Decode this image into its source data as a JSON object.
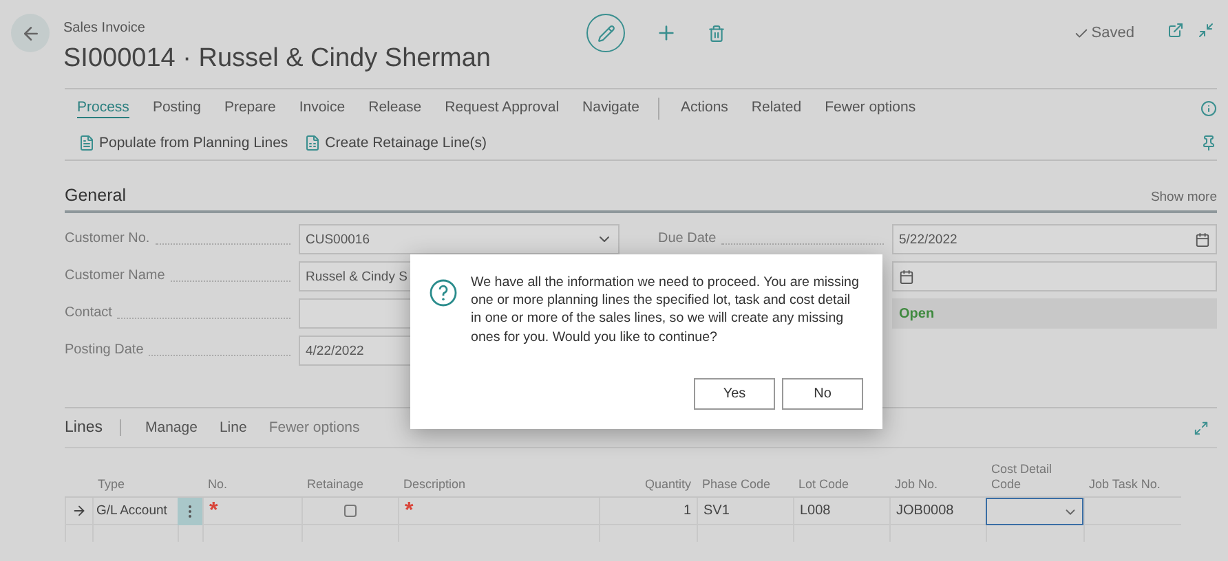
{
  "header": {
    "caption": "Sales Invoice",
    "title": "SI000014 · Russel & Cindy Sherman",
    "status": "Saved"
  },
  "action_tabs": [
    {
      "label": "Process",
      "selected": true
    },
    {
      "label": "Posting",
      "selected": false
    },
    {
      "label": "Prepare",
      "selected": false
    },
    {
      "label": "Invoice",
      "selected": false
    },
    {
      "label": "Release",
      "selected": false
    },
    {
      "label": "Request Approval",
      "selected": false
    },
    {
      "label": "Navigate",
      "selected": false
    },
    {
      "label": "Actions",
      "selected": false
    },
    {
      "label": "Related",
      "selected": false
    },
    {
      "label": "Fewer options",
      "selected": false
    }
  ],
  "actions": [
    "Populate from Planning Lines",
    "Create Retainage Line(s)"
  ],
  "general": {
    "title": "General",
    "show_more": "Show more",
    "left_fields": [
      {
        "label": "Customer No.",
        "value": "CUS00016",
        "kind": "dropdown"
      },
      {
        "label": "Customer Name",
        "value": "Russel & Cindy S",
        "kind": "text"
      },
      {
        "label": "Contact",
        "kind": "text"
      },
      {
        "label": "Posting Date",
        "value": "4/22/2022",
        "kind": "text"
      }
    ],
    "right_fields": [
      {
        "label": "Due Date",
        "value": "5/22/2022",
        "kind": "date"
      },
      {
        "kind": "date"
      },
      {
        "value": "Open",
        "kind": "status"
      }
    ]
  },
  "lines": {
    "title": "Lines",
    "menu": [
      "Manage",
      "Line",
      "Fewer options"
    ],
    "columns": [
      "Type",
      "No.",
      "Retainage",
      "Description",
      "Quantity",
      "Phase Code",
      "Lot Code",
      "Job No.",
      "Cost Detail Code",
      "Job Task No."
    ],
    "rows": [
      {
        "type": "G/L Account",
        "no": "*",
        "retainage": false,
        "description": "*",
        "quantity": "1",
        "phase_code": "SV1",
        "lot_code": "L008",
        "job_no": "JOB0008"
      }
    ]
  },
  "dialog": {
    "message": "We have all the information we need to proceed. You are missing one or more planning lines the specified lot, task and cost detail in one or more of the sales lines, so we will create any missing ones for you. Would you like to continue?",
    "buttons": [
      "Yes",
      "No"
    ]
  }
}
